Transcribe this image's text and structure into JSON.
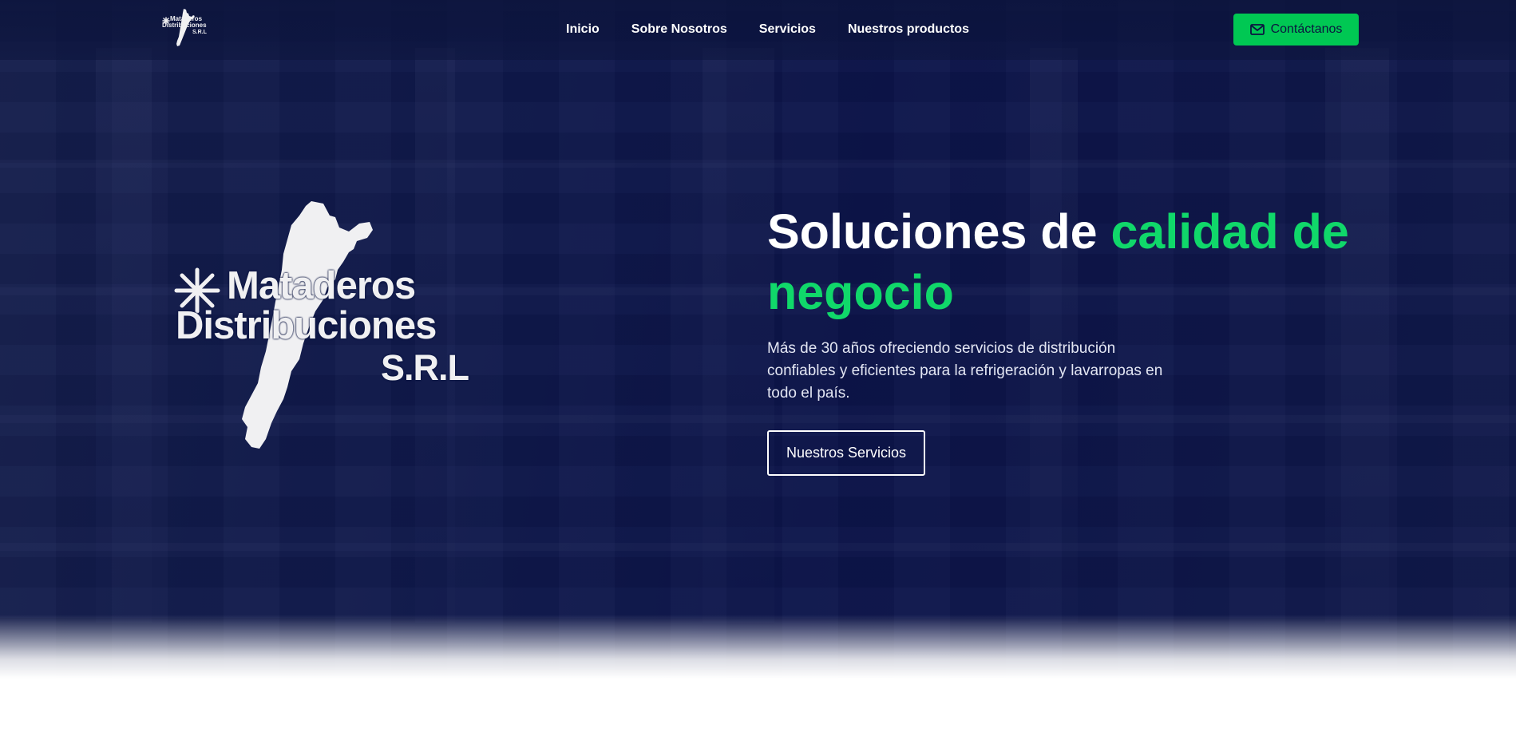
{
  "nav": {
    "logo": {
      "line1": "Mataderos",
      "line2": "Distribuciones",
      "line3": "S.R.L"
    },
    "links": [
      "Inicio",
      "Sobre Nosotros",
      "Servicios",
      "Nuestros productos"
    ],
    "contact_label": "Contáctanos",
    "contact_icon": "mail-icon"
  },
  "hero": {
    "logo": {
      "line1": "Mataderos",
      "line2": "Distribuciones",
      "line3": "S.R.L"
    },
    "title_plain": "Soluciones de ",
    "title_accent": "calidad de negocio",
    "subtitle": "Más de 30 años ofreciendo servicios de distribución confiables y eficientes para la refrigeración y lavarropas en todo el país.",
    "cta_label": "Nuestros Servicios"
  },
  "colors": {
    "accent": "#10d86a",
    "button_green": "#00c853",
    "navy": "#0f1a4a"
  }
}
